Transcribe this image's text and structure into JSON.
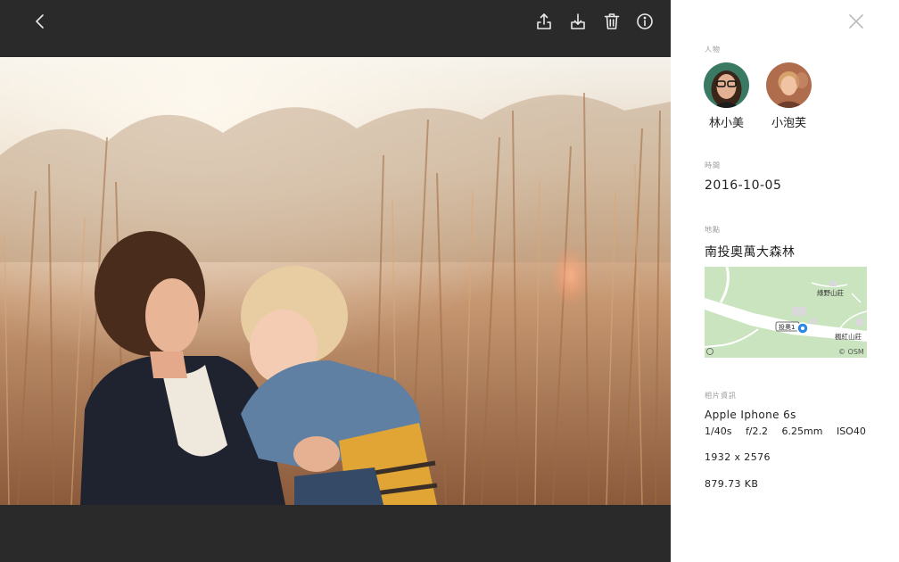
{
  "toolbar": {
    "back_icon": "chevron-left-icon",
    "share_icon": "share-icon",
    "download_icon": "download-icon",
    "delete_icon": "trash-icon",
    "info_icon": "info-icon"
  },
  "panel": {
    "close_icon": "close-icon",
    "people": {
      "label": "人物",
      "items": [
        {
          "name": "林小美"
        },
        {
          "name": "小泡芙"
        }
      ]
    },
    "time": {
      "label": "時間",
      "value": "2016-10-05"
    },
    "location": {
      "label": "地點",
      "value": "南投奧萬大森林",
      "map": {
        "labels": [
          "綠野山莊",
          "投奧1",
          "楓紅山莊"
        ],
        "attribution": "© OSM",
        "pin_color": "#2f88e8"
      }
    },
    "photo_info": {
      "label": "相片資訊",
      "camera": "Apple Iphone 6s",
      "shutter": "1/40s",
      "aperture": "f/2.2",
      "focal_length": "6.25mm",
      "iso": "ISO40",
      "dimensions": "1932 x 2576",
      "file_size": "879.73 KB"
    }
  }
}
